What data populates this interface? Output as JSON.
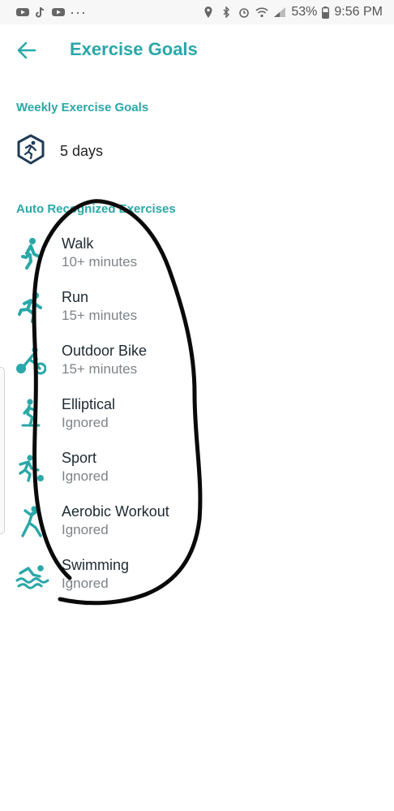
{
  "status_bar": {
    "battery": "53%",
    "time": "9:56 PM",
    "dots": "···"
  },
  "header": {
    "title": "Exercise Goals"
  },
  "weekly": {
    "section_label": "Weekly Exercise Goals",
    "value": "5 days"
  },
  "auto": {
    "section_label": "Auto Recognized Exercises",
    "items": [
      {
        "name": "Walk",
        "detail": "10+ minutes"
      },
      {
        "name": "Run",
        "detail": "15+ minutes"
      },
      {
        "name": "Outdoor Bike",
        "detail": "15+ minutes"
      },
      {
        "name": "Elliptical",
        "detail": "Ignored"
      },
      {
        "name": "Sport",
        "detail": "Ignored"
      },
      {
        "name": "Aerobic Workout",
        "detail": "Ignored"
      },
      {
        "name": "Swimming",
        "detail": "Ignored"
      }
    ]
  },
  "colors": {
    "accent": "#2aa7a8",
    "icon_navy": "#1f3b57"
  }
}
